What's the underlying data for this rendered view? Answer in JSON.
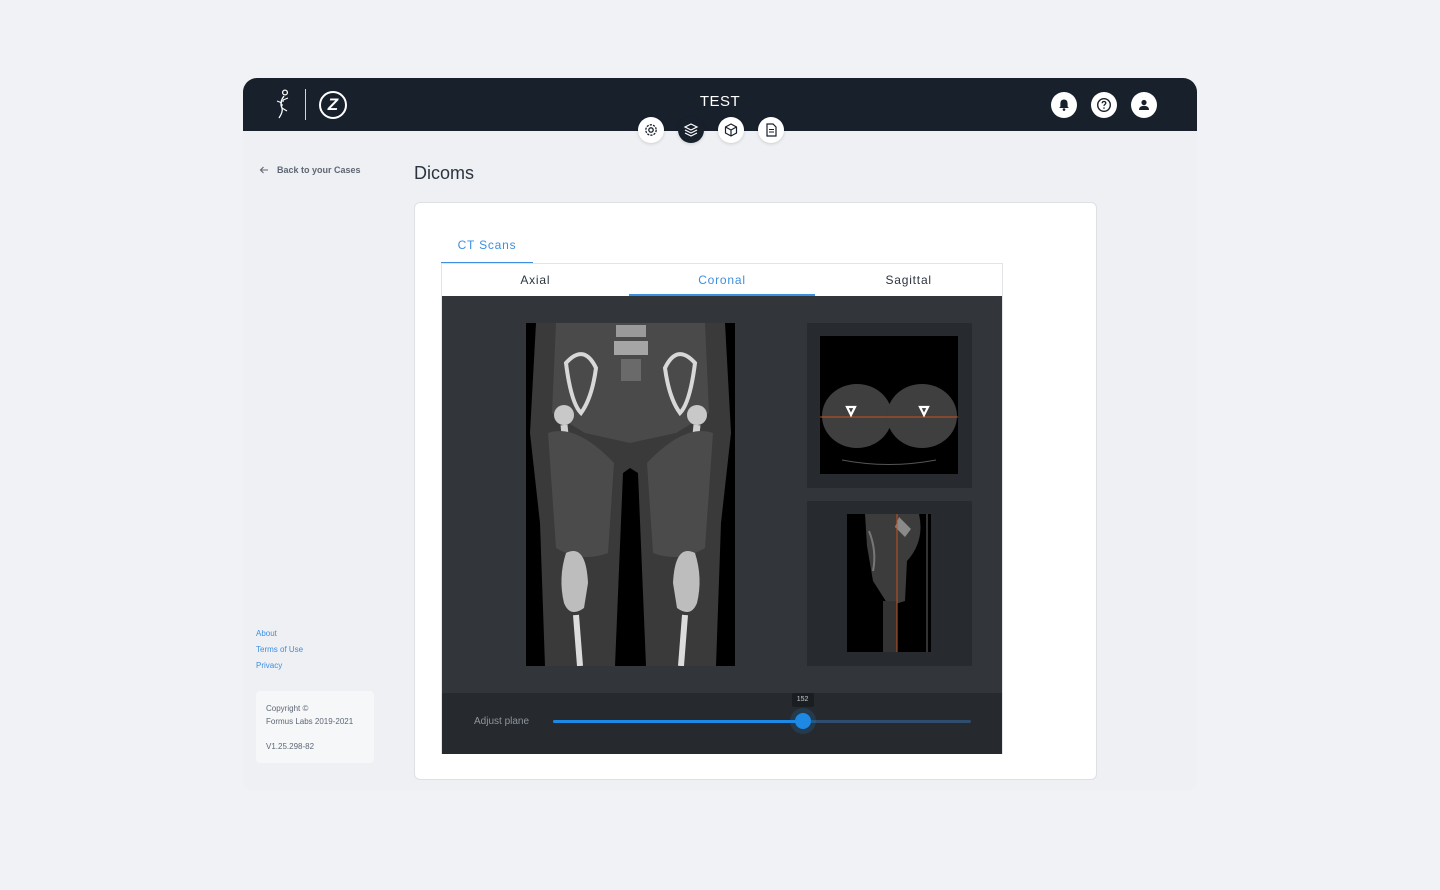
{
  "header": {
    "case_title": "TEST",
    "logos": [
      "figure-logo",
      "zimmer-z-logo"
    ],
    "actions": [
      "bell-icon",
      "help-icon",
      "user-icon"
    ],
    "steps": [
      {
        "icon": "gear-icon",
        "active": false
      },
      {
        "icon": "layers-icon",
        "active": true
      },
      {
        "icon": "cube-icon",
        "active": false
      },
      {
        "icon": "document-icon",
        "active": false
      }
    ]
  },
  "sidebar": {
    "back_label": "Back to your Cases",
    "links": [
      "About",
      "Terms of Use",
      "Privacy"
    ],
    "copyright_line1": "Copyright ©",
    "copyright_line2": "Formus Labs 2019-2021",
    "version": "V1.25.298-82"
  },
  "main": {
    "page_title": "Dicoms",
    "scan_tab": "CT Scans",
    "plane_tabs": [
      {
        "label": "Axial",
        "active": false
      },
      {
        "label": "Coronal",
        "active": true
      },
      {
        "label": "Sagittal",
        "active": false
      }
    ],
    "slider": {
      "label": "Adjust plane",
      "value": "152",
      "fraction": 0.597
    }
  },
  "colors": {
    "header_bg": "#18202c",
    "accent": "#3d8fe0",
    "slider_accent": "#1e88e5",
    "crosshair": "#c8501e"
  }
}
